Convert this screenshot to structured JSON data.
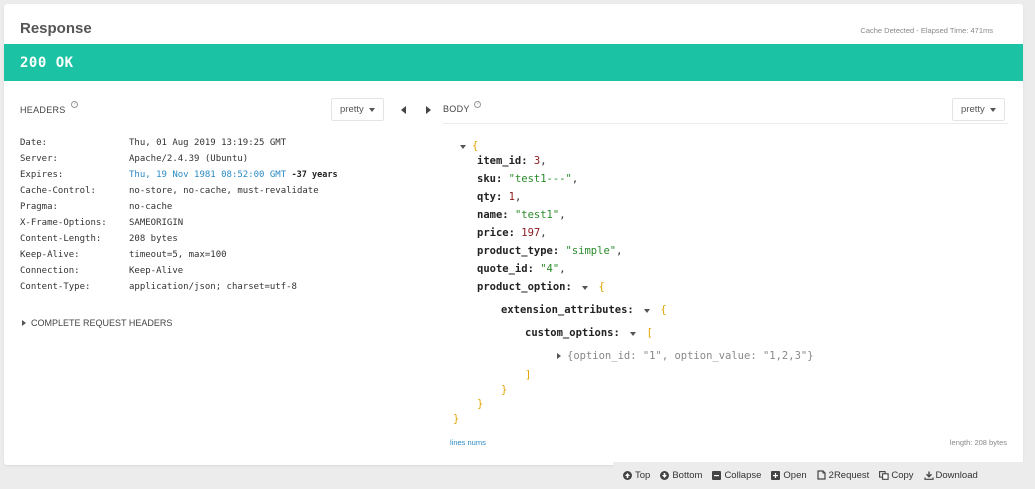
{
  "title": "Response",
  "cache_info": "Cache Detected - Elapsed Time: 471ms",
  "status": "200 OK",
  "headers_section": {
    "label": "HEADERS",
    "format": "pretty",
    "rows": [
      {
        "key": "Date:",
        "value": "Thu, 01 Aug 2019 13:19:25 GMT"
      },
      {
        "key": "Server:",
        "value": "Apache/2.4.39 (Ubuntu)"
      },
      {
        "key": "Expires:",
        "value": "Thu, 19 Nov 1981 08:52:00 GMT",
        "note": "-37 years"
      },
      {
        "key": "Cache-Control:",
        "value": "no-store, no-cache, must-revalidate"
      },
      {
        "key": "Pragma:",
        "value": "no-cache"
      },
      {
        "key": "X-Frame-Options:",
        "value": "SAMEORIGIN"
      },
      {
        "key": "Content-Length:",
        "value": "208 bytes"
      },
      {
        "key": "Keep-Alive:",
        "value": "timeout=5, max=100"
      },
      {
        "key": "Connection:",
        "value": "Keep-Alive"
      },
      {
        "key": "Content-Type:",
        "value": "application/json; charset=utf-8"
      }
    ],
    "complete_request_label": "COMPLETE REQUEST HEADERS"
  },
  "body_section": {
    "label": "BODY",
    "format": "pretty",
    "lines_nums": "lines nums",
    "length": "length: 208 bytes",
    "json": {
      "item_id_key": "item_id:",
      "item_id_val": "3",
      "sku_key": "sku:",
      "sku_val": "\"test1---\"",
      "qty_key": "qty:",
      "qty_val": "1",
      "name_key": "name:",
      "name_val": "\"test1\"",
      "price_key": "price:",
      "price_val": "197",
      "product_type_key": "product_type:",
      "product_type_val": "\"simple\"",
      "quote_id_key": "quote_id:",
      "quote_id_val": "\"4\"",
      "product_option_key": "product_option:",
      "extension_attributes_key": "extension_attributes:",
      "custom_options_key": "custom_options:",
      "collapsed_item": "{option_id:  \"1\", option_value:  \"1,2,3\"}"
    }
  },
  "toolbar": {
    "top": "Top",
    "bottom": "Bottom",
    "collapse": "Collapse",
    "open": "Open",
    "request": "2Request",
    "copy": "Copy",
    "download": "Download"
  },
  "icons": [
    "help-icon",
    "caret-down-icon",
    "arrow-left-icon",
    "arrow-right-icon",
    "expand-icon",
    "collapse-icon",
    "arrow-up-icon",
    "arrow-down-icon",
    "minus-icon",
    "plus-icon",
    "request-icon",
    "copy-icon",
    "download-icon"
  ],
  "colors": {
    "status_bar": "#1bc2a3",
    "link": "#2a8ac4",
    "json_number": "#8b1a1a",
    "json_string": "#2a8b2a",
    "json_brace": "#e0a400"
  }
}
